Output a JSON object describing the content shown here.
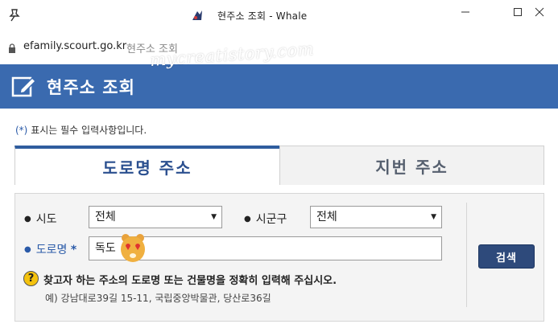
{
  "browser": {
    "tab_title": "현주소 조회 - Whale",
    "url": "efamily.scourt.go.kr",
    "url_page_title": "현주소 조회",
    "watermark": "mycreatistory.com"
  },
  "header": {
    "title": "현주소 조회"
  },
  "notice": {
    "star": "(*)",
    "text": "표시는 필수 입력사항입니다."
  },
  "tabs": [
    {
      "label": "도로명 주소",
      "active": true
    },
    {
      "label": "지번 주소",
      "active": false
    }
  ],
  "form": {
    "sido_label": "시도",
    "sido_value": "전체",
    "sigungu_label": "시군구",
    "sigungu_value": "전체",
    "road_label": "도로명",
    "road_required": "*",
    "road_value": "독도",
    "search_button": "검색",
    "help_text": "찾고자 하는 주소의 도로명 또는 건물명을 정확히 입력해 주십시오.",
    "example": "예) 강남대로39길 15-11, 국립중앙박물관, 당산로36길"
  },
  "colors": {
    "header": "#3a6aaf",
    "tab_active": "#2f5d9e",
    "button": "#2e4a7b"
  }
}
